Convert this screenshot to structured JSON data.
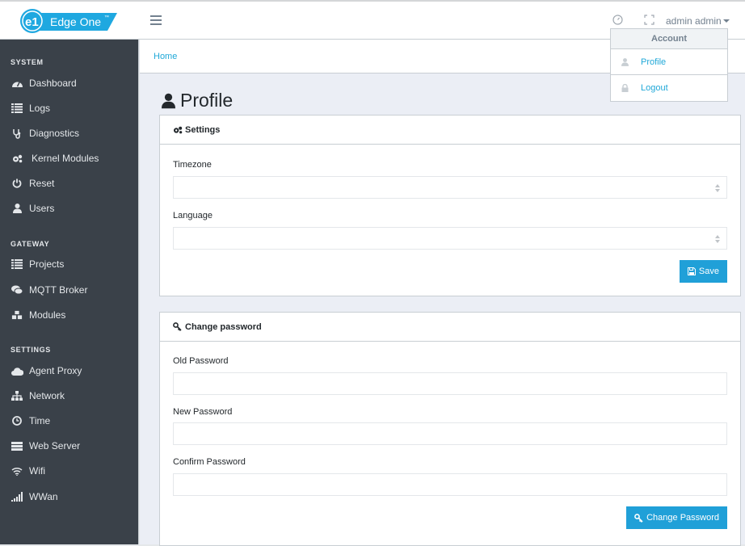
{
  "app": {
    "brand": "Edge One",
    "brand_tm": "™",
    "user_name": "admin admin"
  },
  "dropdown": {
    "header": "Account",
    "items": [
      {
        "label": "Profile",
        "icon": "user-icon"
      },
      {
        "label": "Logout",
        "icon": "lock-icon"
      }
    ]
  },
  "sidebar": {
    "sections": [
      {
        "title": "SYSTEM",
        "items": [
          {
            "label": "Dashboard",
            "icon": "dashboard-icon"
          },
          {
            "label": "Logs",
            "icon": "list-icon"
          },
          {
            "label": "Diagnostics",
            "icon": "stethoscope-icon"
          },
          {
            "label": "Kernel Modules",
            "icon": "cogs-icon"
          },
          {
            "label": "Reset",
            "icon": "power-icon"
          },
          {
            "label": "Users",
            "icon": "user-icon"
          }
        ]
      },
      {
        "title": "GATEWAY",
        "items": [
          {
            "label": "Projects",
            "icon": "list-icon"
          },
          {
            "label": "MQTT Broker",
            "icon": "comments-icon"
          },
          {
            "label": "Modules",
            "icon": "cubes-icon"
          }
        ]
      },
      {
        "title": "SETTINGS",
        "items": [
          {
            "label": "Agent Proxy",
            "icon": "cloud-icon"
          },
          {
            "label": "Network",
            "icon": "sitemap-icon"
          },
          {
            "label": "Time",
            "icon": "clock-icon"
          },
          {
            "label": "Web Server",
            "icon": "server-icon"
          },
          {
            "label": "Wifi",
            "icon": "wifi-icon"
          },
          {
            "label": "WWan",
            "icon": "signal-icon"
          }
        ]
      }
    ]
  },
  "breadcrumb": {
    "home": "Home"
  },
  "page": {
    "title": "Profile"
  },
  "settings_card": {
    "title": "Settings",
    "timezone_label": "Timezone",
    "timezone_value": "",
    "language_label": "Language",
    "language_value": "",
    "save_label": "Save"
  },
  "password_card": {
    "title": "Change password",
    "old_label": "Old Password",
    "new_label": "New Password",
    "confirm_label": "Confirm Password",
    "old_value": "",
    "new_value": "",
    "confirm_value": "",
    "submit_label": "Change Password"
  }
}
